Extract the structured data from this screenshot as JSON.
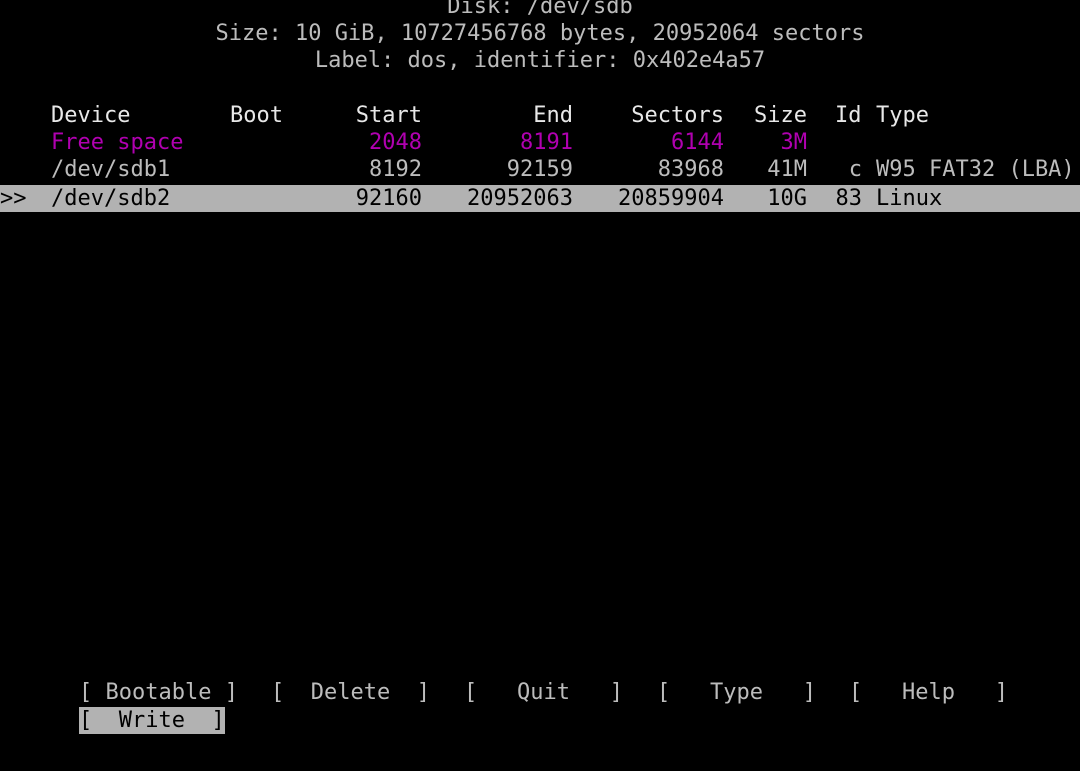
{
  "header": {
    "disk": "Disk: /dev/sdb",
    "size": "Size: 10 GiB, 10727456768 bytes, 20952064 sectors",
    "label": "Label: dos, identifier: 0x402e4a57"
  },
  "table": {
    "columns": {
      "device": "Device",
      "boot": "Boot",
      "start": "Start",
      "end": "End",
      "sectors": "Sectors",
      "size": "Size",
      "id": "Id",
      "type": "Type"
    },
    "rows": [
      {
        "device": "Free space",
        "boot": "",
        "start": "2048",
        "end": "8191",
        "sectors": "6144",
        "size": "3M",
        "id": "",
        "type": ""
      },
      {
        "device": "/dev/sdb1",
        "boot": "",
        "start": "8192",
        "end": "92159",
        "sectors": "83968",
        "size": "41M",
        "id": "c",
        "type": "W95 FAT32 (LBA)"
      },
      {
        "device": "/dev/sdb2",
        "boot": "",
        "start": "92160",
        "end": "20952063",
        "sectors": "20859904",
        "size": "10G",
        "id": "83",
        "type": "Linux"
      }
    ],
    "selected_pointer": ">>"
  },
  "menu": {
    "bootable": "[ Bootable ]",
    "delete": "[  Delete  ]",
    "quit": "[   Quit   ]",
    "type": "[   Type   ]",
    "help": "[   Help   ]",
    "write": "[  Write  ]"
  },
  "colors": {
    "background": "#000000",
    "text": "#bcbcbc",
    "free_space": "#b000b0",
    "selection_bg": "#b2b2b2"
  }
}
